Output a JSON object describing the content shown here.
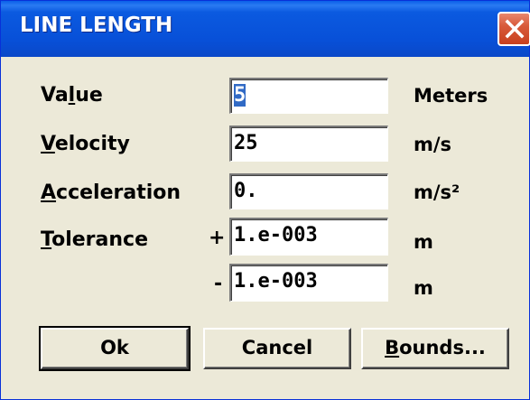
{
  "window": {
    "title": "LINE LENGTH"
  },
  "rows": [
    {
      "label_pre": "Va",
      "label_ul": "l",
      "label_post": "ue",
      "value": "5",
      "unit": "Meters"
    },
    {
      "label_pre": "",
      "label_ul": "V",
      "label_post": "elocity",
      "value": "25",
      "unit": "m/s"
    },
    {
      "label_pre": "",
      "label_ul": "A",
      "label_post": "cceleration",
      "value": "0.",
      "unit": "m/s²"
    },
    {
      "label_pre": "",
      "label_ul": "T",
      "label_post": "olerance",
      "sign": "+",
      "value": "1.e-003",
      "unit": "m"
    },
    {
      "sign": "-",
      "value": "1.e-003",
      "unit": "m"
    }
  ],
  "buttons": {
    "ok": "Ok",
    "cancel": "Cancel",
    "bounds_ul": "B",
    "bounds_rest": "ounds..."
  },
  "icons": {
    "close": "close-icon"
  },
  "colors": {
    "titlebar": "#0A52DC",
    "close_button": "#D85A3A",
    "dialog_bg": "#ECE9D8",
    "selection": "#316AC5"
  }
}
